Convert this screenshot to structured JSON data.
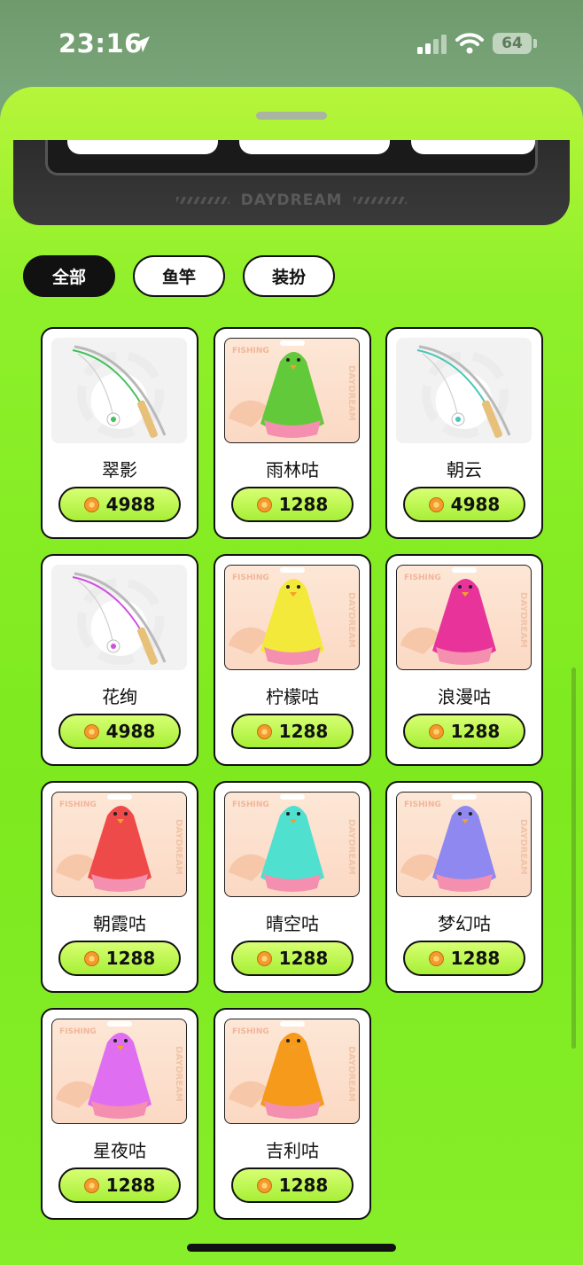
{
  "status": {
    "time": "23:16",
    "battery": "64"
  },
  "brand": "DAYDREAM",
  "tabs": [
    {
      "label": "全部",
      "active": true
    },
    {
      "label": "鱼竿",
      "active": false
    },
    {
      "label": "装扮",
      "active": false
    }
  ],
  "items": [
    {
      "name": "翠影",
      "price": "4988",
      "kind": "rod",
      "color": "#3fc35a"
    },
    {
      "name": "雨林咕",
      "price": "1288",
      "kind": "gu",
      "color": "#62c93a"
    },
    {
      "name": "朝云",
      "price": "4988",
      "kind": "rod",
      "color": "#48c6b8"
    },
    {
      "name": "花绚",
      "price": "4988",
      "kind": "rod",
      "color": "#d04ee0"
    },
    {
      "name": "柠檬咕",
      "price": "1288",
      "kind": "gu",
      "color": "#f3e93a"
    },
    {
      "name": "浪漫咕",
      "price": "1288",
      "kind": "gu",
      "color": "#e8349a"
    },
    {
      "name": "朝霞咕",
      "price": "1288",
      "kind": "gu",
      "color": "#ef4a4a"
    },
    {
      "name": "晴空咕",
      "price": "1288",
      "kind": "gu",
      "color": "#4fe0d0"
    },
    {
      "name": "梦幻咕",
      "price": "1288",
      "kind": "gu",
      "color": "#8e88f0"
    },
    {
      "name": "星夜咕",
      "price": "1288",
      "kind": "gu",
      "color": "#e06ef0"
    },
    {
      "name": "吉利咕",
      "price": "1288",
      "kind": "gu",
      "color": "#f59a1a"
    }
  ]
}
